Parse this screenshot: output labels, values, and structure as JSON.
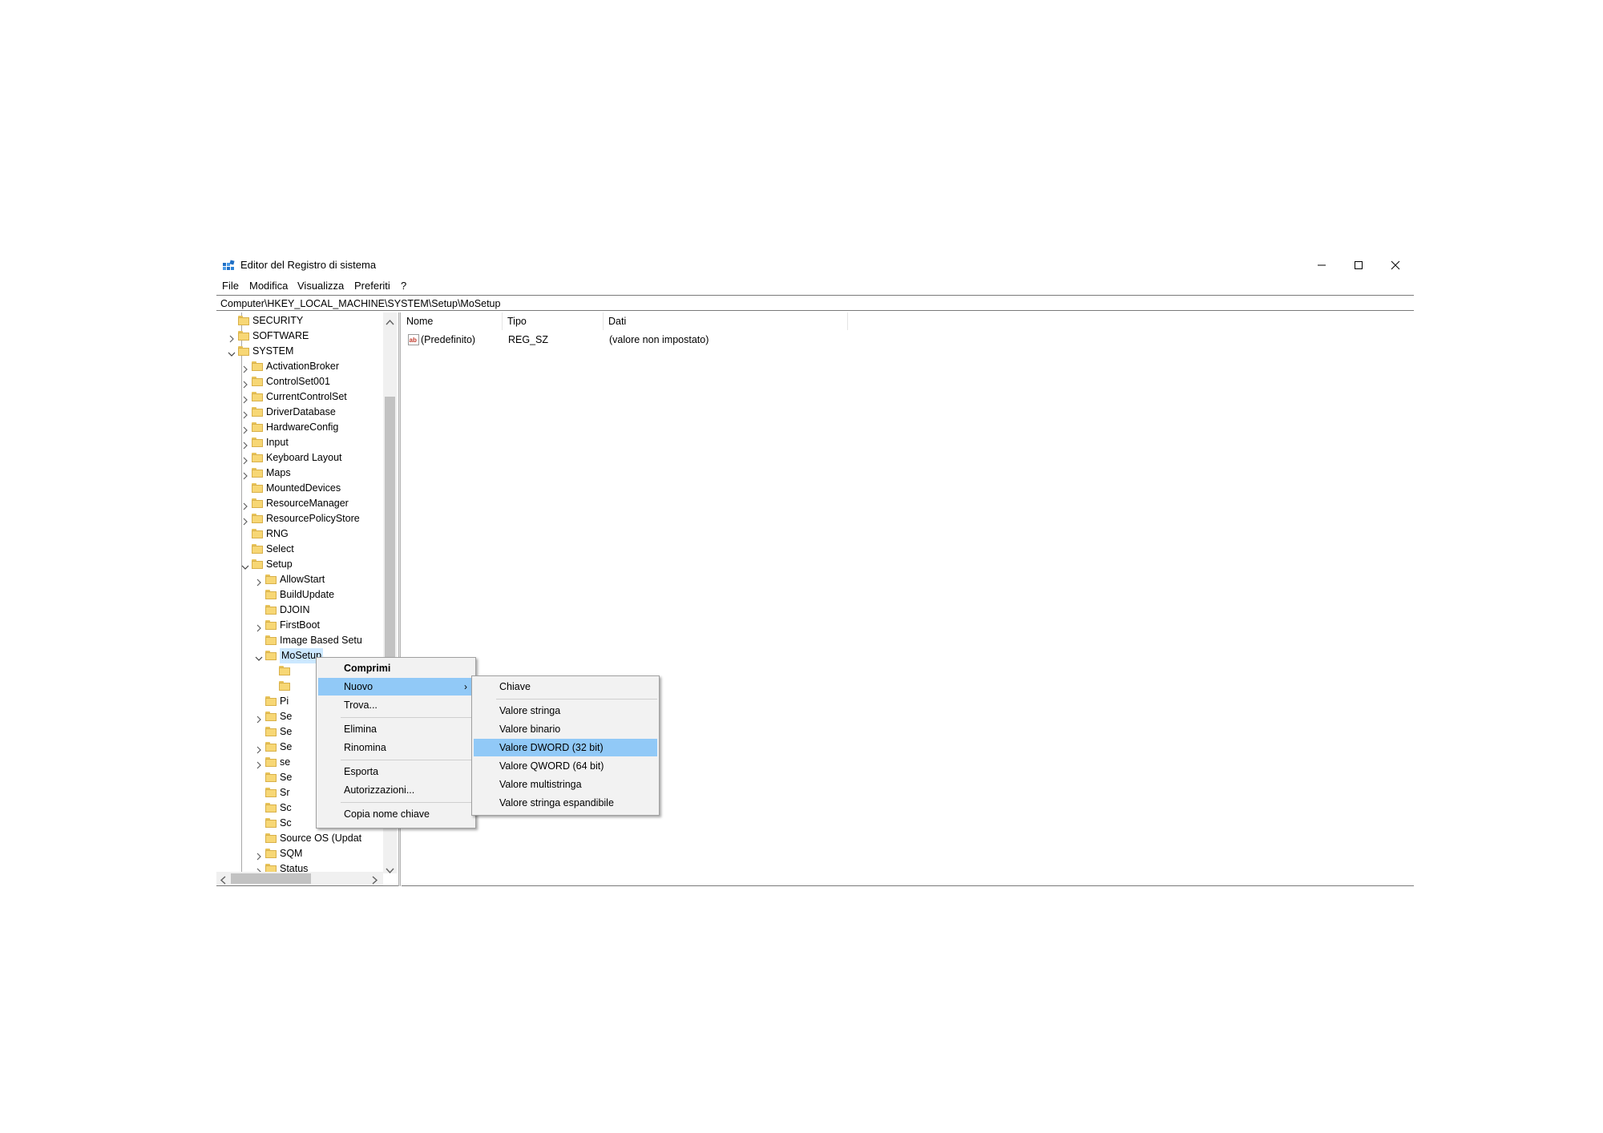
{
  "window": {
    "title": "Editor del Registro di sistema",
    "controls": {
      "minimize": "minimize-icon",
      "maximize": "maximize-icon",
      "close": "close-icon"
    }
  },
  "menubar": [
    "File",
    "Modifica",
    "Visualizza",
    "Preferiti",
    "?"
  ],
  "address": "Computer\\HKEY_LOCAL_MACHINE\\SYSTEM\\Setup\\MoSetup",
  "tree": [
    {
      "label": "SECURITY",
      "level": 0,
      "chevron": "none"
    },
    {
      "label": "SOFTWARE",
      "level": 0,
      "chevron": "right"
    },
    {
      "label": "SYSTEM",
      "level": 0,
      "chevron": "down"
    },
    {
      "label": "ActivationBroker",
      "level": 1,
      "chevron": "right"
    },
    {
      "label": "ControlSet001",
      "level": 1,
      "chevron": "right"
    },
    {
      "label": "CurrentControlSet",
      "level": 1,
      "chevron": "right"
    },
    {
      "label": "DriverDatabase",
      "level": 1,
      "chevron": "right"
    },
    {
      "label": "HardwareConfig",
      "level": 1,
      "chevron": "right"
    },
    {
      "label": "Input",
      "level": 1,
      "chevron": "right"
    },
    {
      "label": "Keyboard Layout",
      "level": 1,
      "chevron": "right"
    },
    {
      "label": "Maps",
      "level": 1,
      "chevron": "right"
    },
    {
      "label": "MountedDevices",
      "level": 1,
      "chevron": "none"
    },
    {
      "label": "ResourceManager",
      "level": 1,
      "chevron": "right"
    },
    {
      "label": "ResourcePolicyStore",
      "level": 1,
      "chevron": "right"
    },
    {
      "label": "RNG",
      "level": 1,
      "chevron": "none"
    },
    {
      "label": "Select",
      "level": 1,
      "chevron": "none"
    },
    {
      "label": "Setup",
      "level": 1,
      "chevron": "down"
    },
    {
      "label": "AllowStart",
      "level": 2,
      "chevron": "right"
    },
    {
      "label": "BuildUpdate",
      "level": 2,
      "chevron": "none"
    },
    {
      "label": "DJOIN",
      "level": 2,
      "chevron": "none"
    },
    {
      "label": "FirstBoot",
      "level": 2,
      "chevron": "right"
    },
    {
      "label": "Image Based Setu",
      "level": 2,
      "chevron": "none"
    },
    {
      "label": "MoSetup",
      "level": 2,
      "chevron": "down"
    },
    {
      "label": "",
      "level": 3,
      "chevron": "none"
    },
    {
      "label": "",
      "level": 3,
      "chevron": "none"
    },
    {
      "label": "Pi",
      "level": 2,
      "chevron": "none"
    },
    {
      "label": "Se",
      "level": 2,
      "chevron": "right"
    },
    {
      "label": "Se",
      "level": 2,
      "chevron": "none"
    },
    {
      "label": "Se",
      "level": 2,
      "chevron": "right"
    },
    {
      "label": "se",
      "level": 2,
      "chevron": "right"
    },
    {
      "label": "Se",
      "level": 2,
      "chevron": "none"
    },
    {
      "label": "Sr",
      "level": 2,
      "chevron": "none"
    },
    {
      "label": "Sc",
      "level": 2,
      "chevron": "none"
    },
    {
      "label": "Sc",
      "level": 2,
      "chevron": "none"
    },
    {
      "label": "Source OS (Updat",
      "level": 2,
      "chevron": "none"
    },
    {
      "label": "SQM",
      "level": 2,
      "chevron": "right"
    },
    {
      "label": "Status",
      "level": 2,
      "chevron": "right"
    }
  ],
  "list": {
    "columns": [
      "Nome",
      "Tipo",
      "Dati"
    ],
    "rows": [
      {
        "name": "(Predefinito)",
        "type": "REG_SZ",
        "data": "(valore non impostato)"
      }
    ]
  },
  "context_menu": {
    "items": [
      "Comprimi",
      "Nuovo",
      "Trova...",
      "Elimina",
      "Rinomina",
      "Esporta",
      "Autorizzazioni...",
      "Copia nome chiave"
    ],
    "highlighted": "Nuovo",
    "submenu_arrow": "›"
  },
  "submenu": {
    "items": [
      "Chiave",
      "Valore stringa",
      "Valore binario",
      "Valore DWORD (32 bit)",
      "Valore QWORD (64 bit)",
      "Valore multistringa",
      "Valore stringa espandibile"
    ],
    "highlighted": "Valore DWORD (32 bit)"
  },
  "colors": {
    "highlight": "#91c9f7",
    "folder": "#f7d775",
    "menu_bg": "#f2f2f2"
  }
}
